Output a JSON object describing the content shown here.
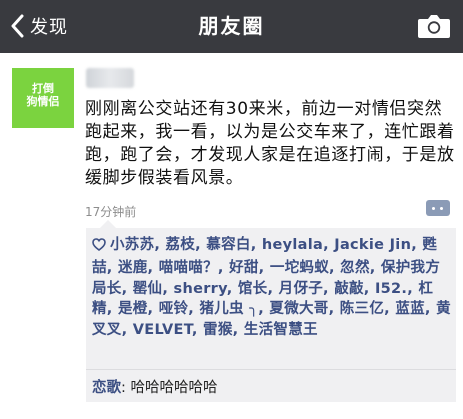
{
  "header": {
    "back_label": "发现",
    "title": "朋友圈"
  },
  "post": {
    "avatar_text_line1": "打倒",
    "avatar_text_line2": "狗情侣",
    "text": "刚刚离公交站还有30来米，前边一对情侣突然跑起来，我一看，以为是公交车来了，连忙跟着跑，跑了会，才发现人家是在追逐打闹，于是放缓脚步假装看风景。",
    "time": "17分钟前"
  },
  "likes": {
    "names": "小苏苏, 荔枝, 慕容白, heylala, Jackie Jin, 甦喆, 迷鹿, 喵喵喵？, 好甜, 一坨蚂蚁, 忽然, 保护我方局长, 罂仙, sherry, 馆长, 月伢子, 敲敲, I52., 杠精, 是橙, 哑铃, 猪儿虫 ╮, 夏微大哥, 陈三亿, 蓝蓝, 黄叉叉, VELVET, 雷猴, 生活智慧王"
  },
  "comments": [
    {
      "name": "恋歌",
      "separator": ": ",
      "text": "哈哈哈哈哈哈"
    }
  ],
  "icons": {
    "back": "chevron-left-icon",
    "camera": "camera-icon",
    "heart": "heart-icon",
    "comment": "comment-more-icon"
  },
  "colors": {
    "header_bg": "#393a3f",
    "link_blue": "#3c4f83",
    "avatar_green": "#7bd33f",
    "social_bg": "#f0f0f2"
  }
}
